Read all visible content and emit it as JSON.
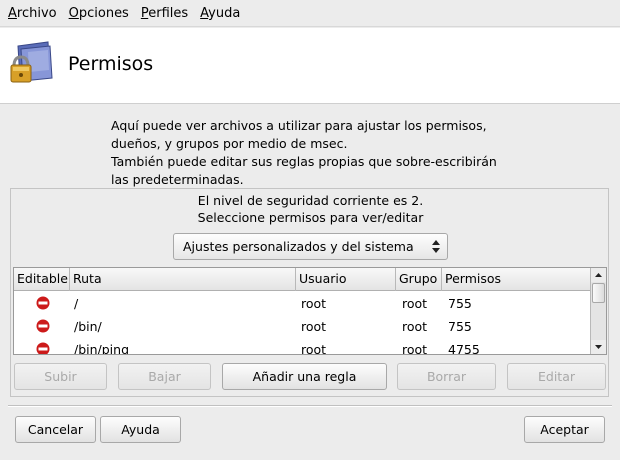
{
  "menubar": {
    "items": [
      {
        "ul": "A",
        "rest": "rchivo"
      },
      {
        "ul": "O",
        "rest": "pciones"
      },
      {
        "ul": "P",
        "rest": "erfiles"
      },
      {
        "ul": "A",
        "rest": "yuda"
      }
    ]
  },
  "header": {
    "title": "Permisos",
    "icon": "folder-lock-icon"
  },
  "intro": {
    "lines": [
      "Aquí puede ver archivos a utilizar para ajustar los permisos,",
      "dueños, y grupos por medio de msec.",
      "También puede editar sus reglas propias que sobre-escribirán",
      "las predeterminadas."
    ]
  },
  "panel": {
    "level_text": "El nivel de seguridad corriente es 2.",
    "select_text": "Seleccione permisos para ver/editar",
    "combo_value": "Ajustes personalizados y del sistema"
  },
  "table": {
    "columns": [
      "Editable",
      "Ruta",
      "Usuario",
      "Grupo",
      "Permisos"
    ],
    "rows": [
      {
        "editable_icon": "no-entry-icon",
        "ruta": "/",
        "usuario": "root",
        "grupo": "root",
        "permisos": "755"
      },
      {
        "editable_icon": "no-entry-icon",
        "ruta": "/bin/",
        "usuario": "root",
        "grupo": "root",
        "permisos": "755"
      },
      {
        "editable_icon": "no-entry-icon",
        "ruta": "/bin/ping",
        "usuario": "root",
        "grupo": "root",
        "permisos": "4755"
      }
    ]
  },
  "actions": {
    "up": "Subir",
    "down": "Bajar",
    "add_rule": "Añadir una regla",
    "delete": "Borrar",
    "edit": "Editar"
  },
  "footer": {
    "cancel": "Cancelar",
    "help": "Ayuda",
    "accept": "Aceptar"
  },
  "colors": {
    "no_entry_red": "#cc1a1a",
    "folder_blue": "#6d7fc8",
    "lock_gold": "#d8a028"
  }
}
